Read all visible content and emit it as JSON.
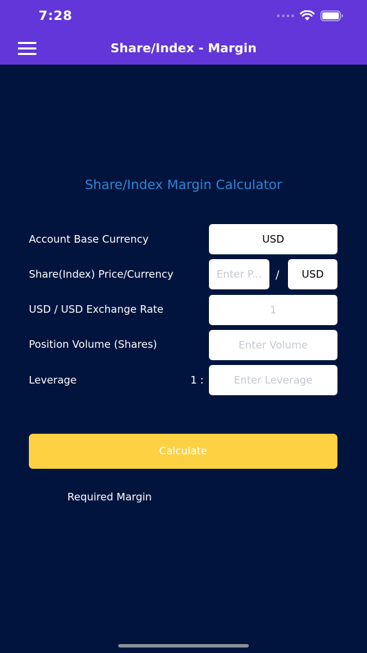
{
  "status_bar": {
    "time": "7:28",
    "icons": [
      "cellular-signal-icon",
      "wifi-icon",
      "battery-icon"
    ]
  },
  "nav": {
    "title": "Share/Index - Margin",
    "menu_icon": "hamburger-menu-icon"
  },
  "calculator": {
    "title": "Share/Index Margin Calculator",
    "rows": {
      "base_currency": {
        "label": "Account Base Currency",
        "value": "USD"
      },
      "price_currency": {
        "label": "Share(Index) Price/Currency",
        "price_placeholder": "Enter P...",
        "separator": "/",
        "currency_value": "USD"
      },
      "exchange_rate": {
        "label": "USD / USD Exchange Rate",
        "value": "1"
      },
      "volume": {
        "label": "Position Volume (Shares)",
        "placeholder": "Enter Volume"
      },
      "leverage": {
        "label": "Leverage",
        "ratio_prefix": "1 :",
        "placeholder": "Enter Leverage"
      }
    },
    "calculate_label": "Calculate",
    "result_label": "Required Margin"
  },
  "colors": {
    "background": "#00143d",
    "header": "#6236d9",
    "title_accent": "#2f86d8",
    "button": "#fdd142"
  }
}
